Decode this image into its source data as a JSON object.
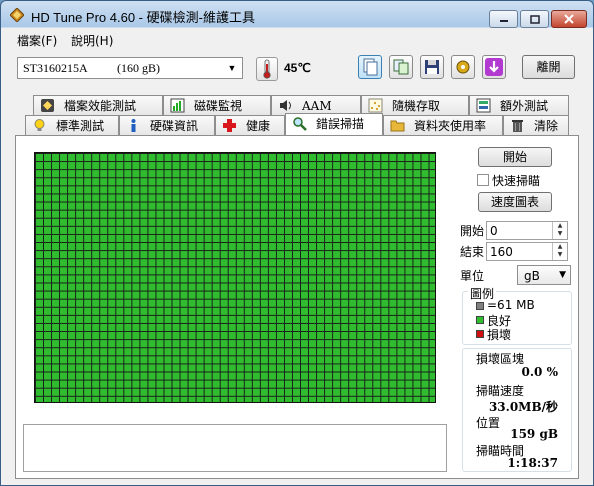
{
  "window": {
    "title": "HD Tune Pro 4.60 - 硬碟檢測-維護工具"
  },
  "menu": {
    "file": "檔案(F)",
    "help": "說明(H)"
  },
  "toolbar": {
    "drive": "ST3160215A          (160 gB)",
    "temperature": "45℃",
    "exit_label": "離開"
  },
  "tabs_row1": [
    {
      "label": "檔案效能測試",
      "icon": "file-benchmark-icon"
    },
    {
      "label": "磁碟監視",
      "icon": "disk-monitor-icon"
    },
    {
      "label": "AAM",
      "icon": "speaker-icon"
    },
    {
      "label": "隨機存取",
      "icon": "random-access-icon"
    },
    {
      "label": "額外測試",
      "icon": "extra-tests-icon"
    }
  ],
  "tabs_row2": [
    {
      "label": "標準測試",
      "icon": "lightbulb-icon"
    },
    {
      "label": "硬碟資訊",
      "icon": "info-icon"
    },
    {
      "label": "健康",
      "icon": "red-cross-icon"
    },
    {
      "label": "錯誤掃描",
      "icon": "magnifier-icon"
    },
    {
      "label": "資料夾使用率",
      "icon": "folder-icon"
    },
    {
      "label": "清除",
      "icon": "trash-icon"
    }
  ],
  "scan": {
    "start_button": "開始",
    "quick_scan_label": "快速掃瞄",
    "quick_scan_checked": false,
    "speed_map_button": "速度圖表",
    "start_label": "開始",
    "start_value": "0",
    "end_label": "結束",
    "end_value": "160",
    "unit_label": "單位",
    "unit_value": "gB"
  },
  "legend": {
    "title": "圖例",
    "block": "=61 MB",
    "good": "良好",
    "bad": "損壞",
    "colors": {
      "block": "#808080",
      "good": "#2fbd2f",
      "bad": "#d01010"
    }
  },
  "stats": {
    "damaged_label": "損壞區塊",
    "damaged_value": "0.0 %",
    "speed_label": "掃瞄速度",
    "speed_value": "33.0MB/秒",
    "position_label": "位置",
    "position_value": "159 gB",
    "time_label": "掃瞄時間",
    "time_value": "1:18:37"
  }
}
